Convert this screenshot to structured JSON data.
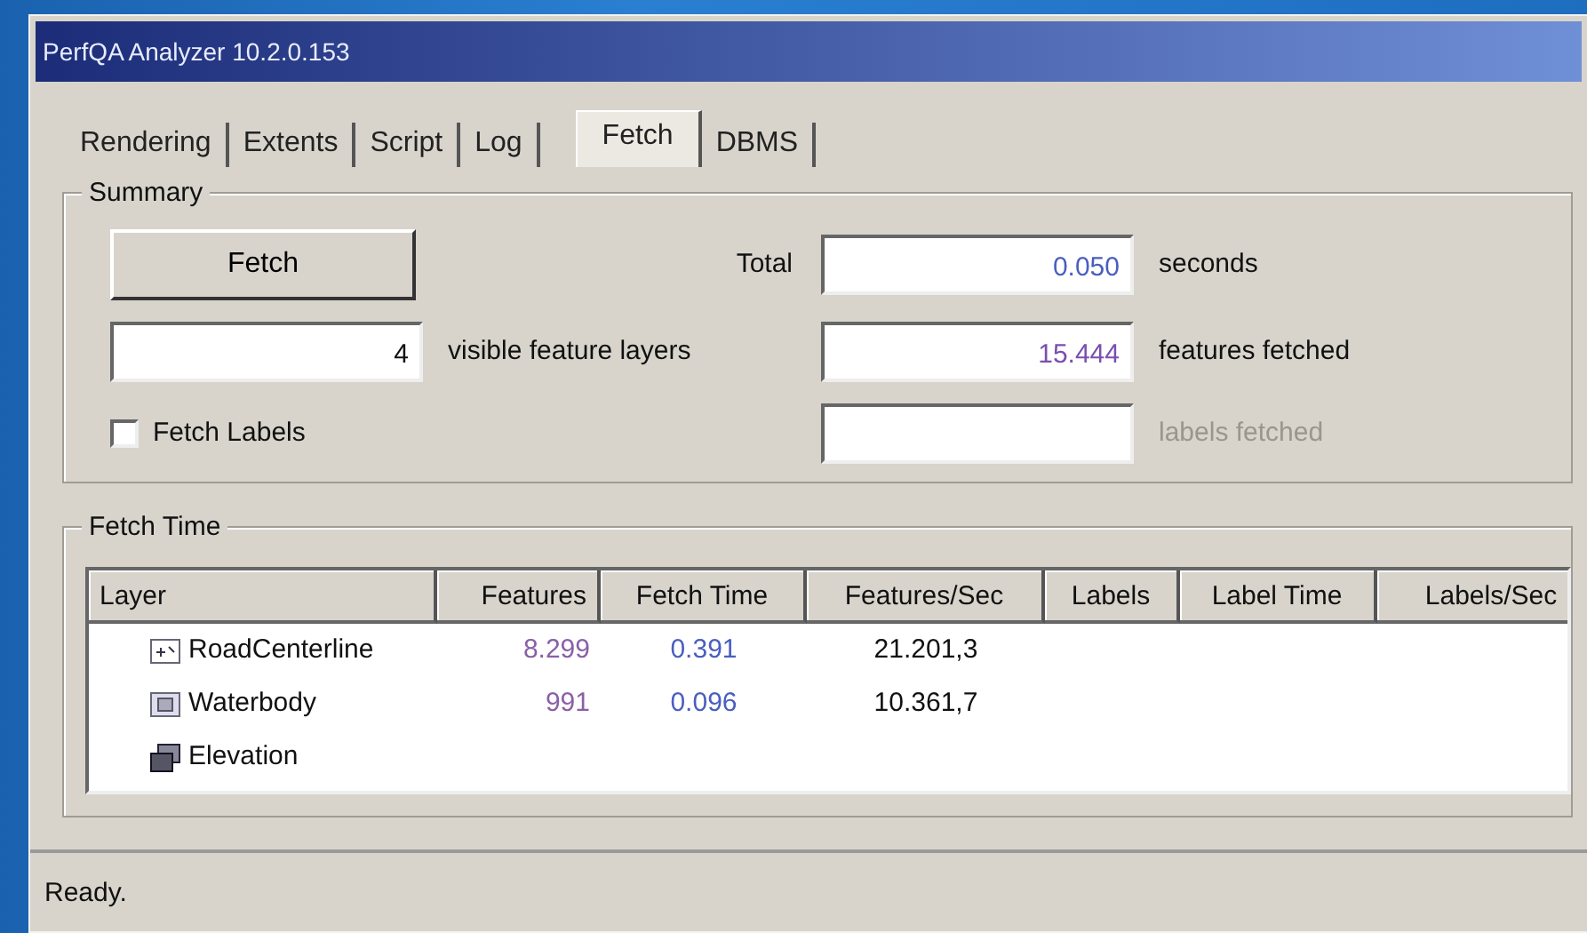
{
  "window": {
    "title": "PerfQA Analyzer 10.2.0.153"
  },
  "tabs": [
    {
      "label": "Rendering",
      "selected": false
    },
    {
      "label": "Extents",
      "selected": false
    },
    {
      "label": "Script",
      "selected": false
    },
    {
      "label": "Log",
      "selected": false
    },
    {
      "label": "Fetch",
      "selected": true
    },
    {
      "label": "DBMS",
      "selected": false
    }
  ],
  "summary": {
    "title": "Summary",
    "fetch_button": "Fetch",
    "total_label": "Total",
    "total_value": "0.050",
    "total_unit": "seconds",
    "layers_value": "4",
    "layers_label": "visible feature layers",
    "features_value": "15.444",
    "features_label": "features fetched",
    "fetch_labels": {
      "label": "Fetch Labels",
      "checked": false
    },
    "labels_fetched_disabled": true,
    "labels_label": "labels fetched"
  },
  "fetch_time": {
    "title": "Fetch Time",
    "columns": [
      "Layer",
      "Features",
      "Fetch Time",
      "Features/Sec",
      "Labels",
      "Label Time",
      "Labels/Sec"
    ],
    "rows": [
      {
        "kind": "line",
        "layer": "RoadCenterline",
        "features": "8.299",
        "fetch_time": "0.391",
        "features_per_sec": "21.201,3"
      },
      {
        "kind": "polygon",
        "layer": "Waterbody",
        "features": "991",
        "fetch_time": "0.096",
        "features_per_sec": "10.361,7"
      },
      {
        "kind": "raster",
        "layer": "Elevation"
      }
    ]
  },
  "status_bar": "Ready."
}
